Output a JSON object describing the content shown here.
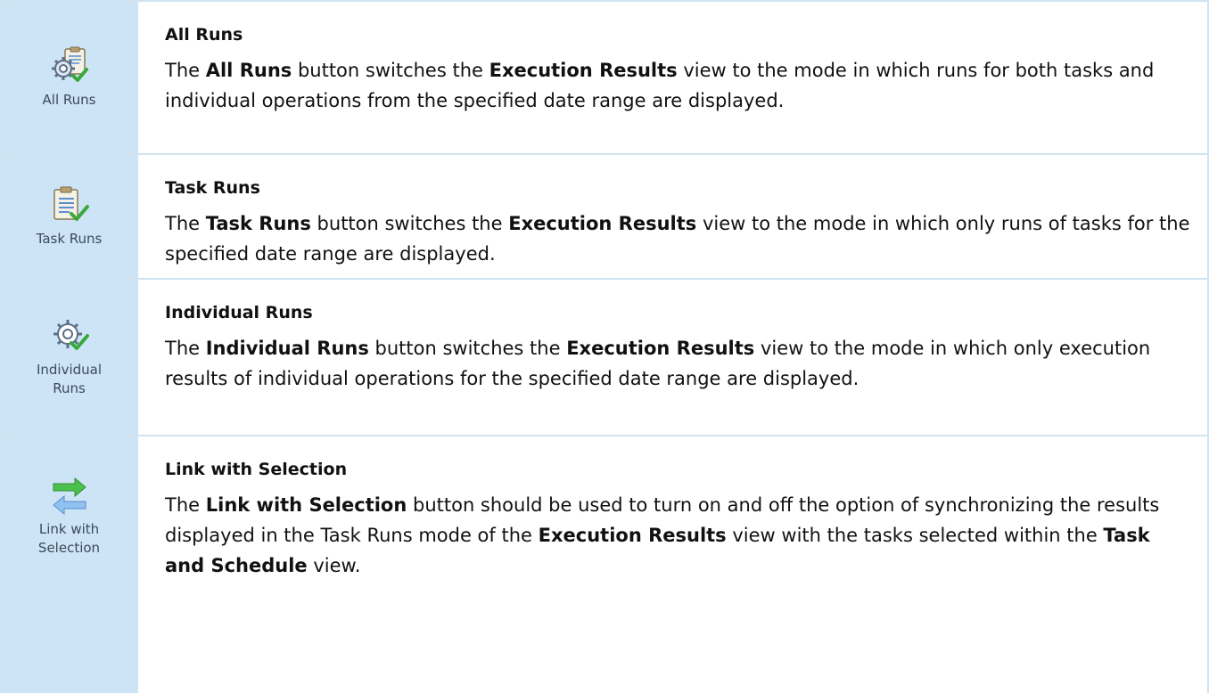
{
  "items": [
    {
      "caption": "All Runs",
      "icon": "gear-clipboard-check-icon",
      "title": "All Runs",
      "desc": {
        "p1": "The ",
        "b1": "All Runs",
        "p2": " button switches the ",
        "b2": "Execution Results",
        "p3": " view to the mode in which runs for both tasks and individual operations from the specified date range are displayed."
      }
    },
    {
      "caption": "Task Runs",
      "icon": "clipboard-check-icon",
      "title": "Task Runs",
      "desc": {
        "p1": "The ",
        "b1": "Task Runs",
        "p2": " button switches the ",
        "b2": "Execution Results",
        "p3": " view to the mode in which only runs of tasks for the specified date range are displayed."
      }
    },
    {
      "caption_line1": "Individual",
      "caption_line2": "Runs",
      "icon": "gear-check-icon",
      "title": "Individual Runs",
      "desc": {
        "p1": "The ",
        "b1": "Individual Runs",
        "p2": " button switches the ",
        "b2": "Execution Results",
        "p3": " view to the mode in which only execution results of individual operations for the specified date range are displayed."
      }
    },
    {
      "caption_line1": "Link with",
      "caption_line2": "Selection",
      "icon": "link-arrows-icon",
      "title": "Link with Selection",
      "desc": {
        "p1": "The ",
        "b1": "Link with Selection",
        "p2": " button should be used to turn on and off the option of synchronizing the results displayed in the Task Runs mode of the ",
        "b2": "Execution Results",
        "p3": " view with the tasks selected within the ",
        "b3": "Task and Schedule",
        "p4": " view."
      }
    }
  ],
  "colors": {
    "icon_cell_bg": "#cde4f7",
    "border": "#cfe3f1",
    "check_green": "#3aa83a",
    "arrow_green": "#4cc04c",
    "arrow_blue": "#8fc2ee"
  }
}
